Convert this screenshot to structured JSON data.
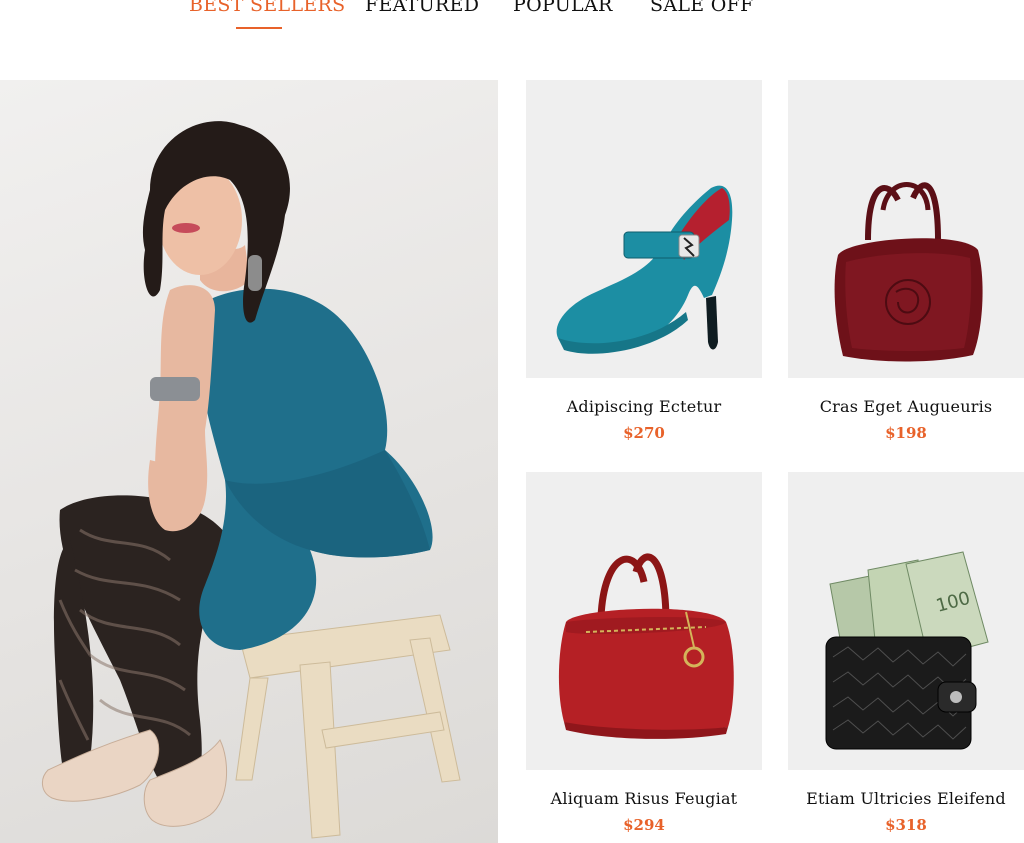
{
  "tabs": [
    {
      "label": "BEST SELLERS",
      "active": true
    },
    {
      "label": "FEATURED",
      "active": false
    },
    {
      "label": "POPULAR",
      "active": false
    },
    {
      "label": "SALE OFF",
      "active": false
    }
  ],
  "colors": {
    "accent": "#e8622a",
    "text": "#111111",
    "card_bg": "#efefef"
  },
  "hero": {
    "image": "woman-in-teal-dress-on-stool"
  },
  "products": [
    {
      "name": "Adipiscing Ectetur",
      "price": "$270",
      "image": "teal-high-heel-shoe"
    },
    {
      "name": "Cras Eget Augueuris",
      "price": "$198",
      "image": "burgundy-handbag"
    },
    {
      "name": "Aliquam Risus Feugiat",
      "price": "$294",
      "image": "red-bowling-bag"
    },
    {
      "name": "Etiam Ultricies Eleifend",
      "price": "$318",
      "image": "wallet-with-cash"
    }
  ]
}
